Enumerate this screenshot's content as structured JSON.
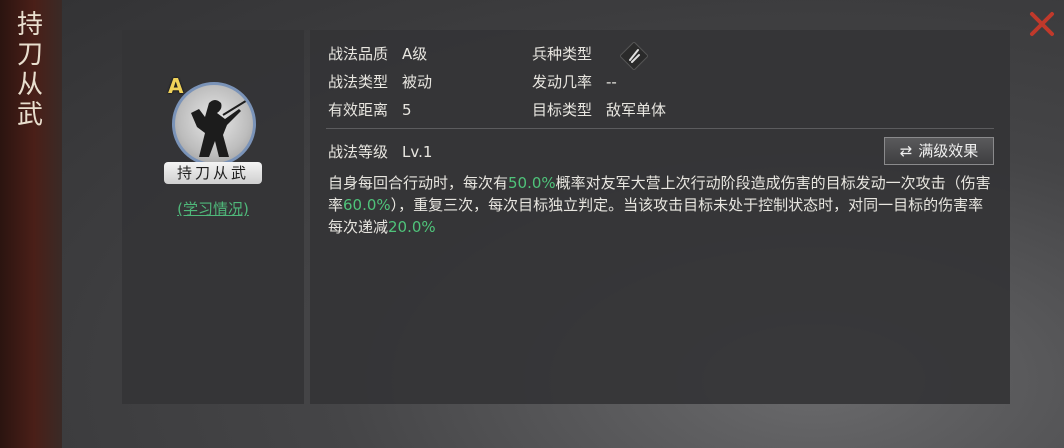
{
  "title_vertical": [
    "持",
    "刀",
    "从",
    "武"
  ],
  "skill": {
    "grade": "A",
    "name": "持刀从武",
    "learn_link": "(学习情况)"
  },
  "attributes": {
    "quality": {
      "label": "战法品质",
      "value": "A级"
    },
    "type": {
      "label": "战法类型",
      "value": "被动"
    },
    "range": {
      "label": "有效距离",
      "value": "5"
    },
    "troop": {
      "label": "兵种类型"
    },
    "trigger": {
      "label": "发动几率",
      "value": "--"
    },
    "target": {
      "label": "目标类型",
      "value": "敌军单体"
    }
  },
  "level": {
    "label": "战法等级",
    "value": "Lv.1"
  },
  "max_button": {
    "icon": "⇄",
    "label": "满级效果"
  },
  "description": {
    "p1": "自身每回合行动时，每次有",
    "h1": "50.0%",
    "p2": "概率对友军大营上次行动阶段造成伤害的目标发动一次攻击（伤害率",
    "h2": "60.0%",
    "p3": "），重复三次，每次目标独立判定。当该攻击目标未处于控制状态时，对同一目标的伤害率每次递减",
    "h3": "20.0%"
  },
  "colors": {
    "highlight": "#4fc37a",
    "close": "#c0392b",
    "link": "#4fb87a"
  }
}
